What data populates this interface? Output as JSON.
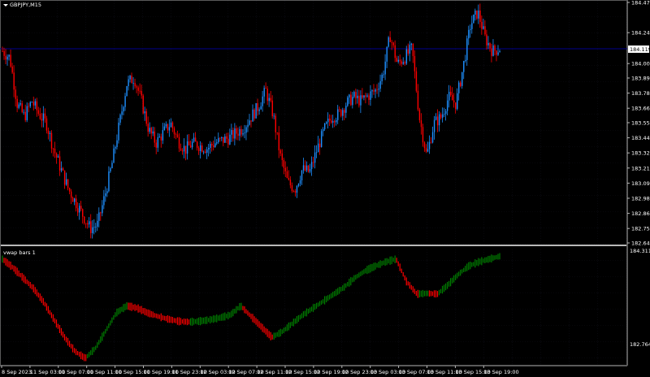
{
  "window": {
    "symbol_title": "GBPJPY,M15"
  },
  "price_pane": {
    "y_ticks": [
      "184.470",
      "184.240",
      "184.005",
      "183.895",
      "183.780",
      "183.665",
      "183.555",
      "183.440",
      "183.325",
      "183.210",
      "183.095",
      "182.980",
      "182.865",
      "182.750",
      "182.640"
    ],
    "current_price": "184.119",
    "current_price_line_color": "#00008b",
    "bull_color": "#1e90ff",
    "bear_color": "#ff0000"
  },
  "indicator_pane": {
    "title": "vwap bars 1",
    "y_top": "184.3113",
    "y_bottom": "182.7647",
    "up_color": "#008000",
    "down_color": "#ff0000"
  },
  "time_axis": {
    "labels": [
      "8 Sep 2023",
      "11 Sep 03:00",
      "11 Sep 07:00",
      "11 Sep 11:00",
      "11 Sep 15:00",
      "11 Sep 19:00",
      "11 Sep 23:00",
      "12 Sep 03:00",
      "12 Sep 07:00",
      "12 Sep 11:00",
      "12 Sep 15:00",
      "12 Sep 19:00",
      "12 Sep 23:00",
      "13 Sep 03:00",
      "13 Sep 07:00",
      "13 Sep 11:00",
      "13 Sep 15:00",
      "13 Sep 19:00"
    ]
  },
  "chart_data": [
    {
      "type": "candlestick",
      "title": "GBPJPY,M15",
      "ylim": [
        182.64,
        184.47
      ],
      "series": [
        {
          "values": [
            184.1,
            184.05,
            183.7,
            183.6,
            183.72,
            183.62,
            183.55,
            183.35,
            183.2,
            183.05,
            182.95,
            182.85,
            182.75,
            182.78,
            183.0,
            183.25,
            183.55,
            183.85,
            183.9,
            183.72,
            183.5,
            183.4,
            183.48,
            183.55,
            183.42,
            183.35,
            183.4,
            183.38,
            183.36,
            183.4,
            183.42,
            183.44,
            183.48,
            183.52,
            183.6,
            183.68,
            183.8,
            183.62,
            183.3,
            183.1,
            183.05,
            183.2,
            183.18,
            183.35,
            183.5,
            183.6,
            183.62,
            183.7,
            183.75,
            183.72,
            183.76,
            183.8,
            183.92,
            184.22,
            184.0,
            184.05,
            184.12,
            183.6,
            183.3,
            183.55,
            183.6,
            183.75,
            183.7,
            183.98,
            184.3,
            184.4,
            184.2,
            184.1,
            184.12
          ]
        }
      ]
    },
    {
      "type": "line",
      "title": "vwap bars 1",
      "ylim": [
        182.7647,
        184.3113
      ],
      "series": [
        {
          "values": [
            184.22,
            184.1,
            183.95,
            183.8,
            183.6,
            183.35,
            183.1,
            182.9,
            182.8,
            182.95,
            183.2,
            183.45,
            183.55,
            183.52,
            183.45,
            183.4,
            183.36,
            183.33,
            183.32,
            183.33,
            183.35,
            183.38,
            183.42,
            183.55,
            183.4,
            183.25,
            183.1,
            183.18,
            183.3,
            183.42,
            183.52,
            183.62,
            183.72,
            183.82,
            183.95,
            184.05,
            184.12,
            184.18,
            184.22,
            183.9,
            183.72,
            183.73,
            183.72,
            183.85,
            184.0,
            184.12,
            184.18,
            184.22,
            184.26
          ]
        }
      ]
    }
  ]
}
